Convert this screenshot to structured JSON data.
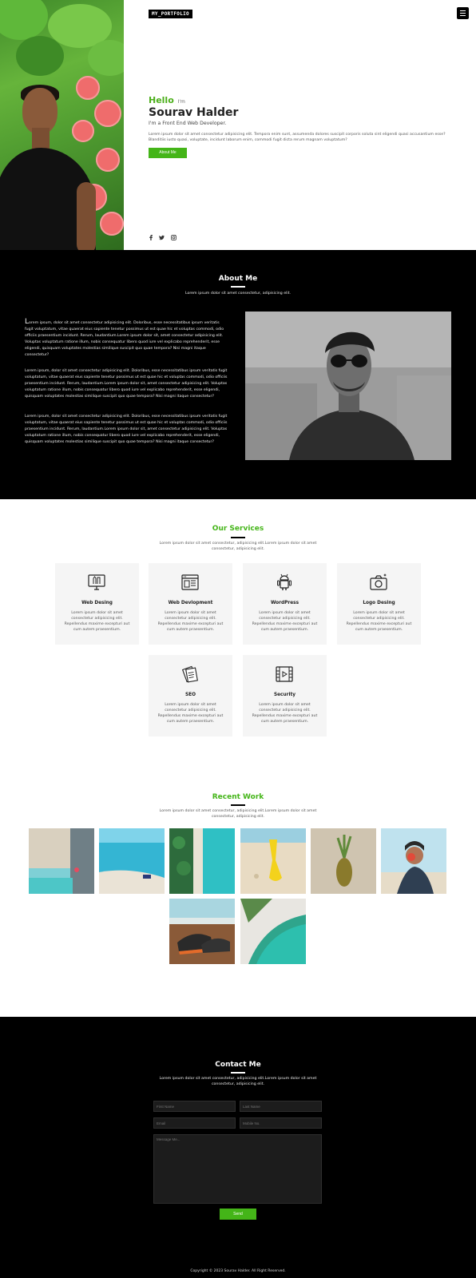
{
  "header": {
    "logo": "MY_PORTFOLIO"
  },
  "hero": {
    "hello": "Hello",
    "im": "I'm",
    "name": "Sourav Halder",
    "role": "I'm a Front End Web Developer.",
    "intro": "Lorem ipsum dolor sit amet consectetur adipisicing elit. Tempora enim sunt, assumenda dolores suscipit corporis soluta sint eligendi quasi accusantium esse? Blanditiis iusto quasi, voluptate, incidunt laborum enim, commodi fugit dicta rerum magnam voluptatum?",
    "button": "About Me",
    "social": [
      "facebook-icon",
      "twitter-icon",
      "instagram-icon"
    ]
  },
  "about": {
    "title": "About Me",
    "subtitle": "Lorem ipsum dolor sit amet consectetur, adipisicing elit.",
    "p1_drop": "L",
    "p1_rest": "orem ipsum, dolor sit amet consectetur adipisicing elit. Doloribus, esse necessitatibus ipsum veritatis fugit voluptatum, vitae quaerat eius sapiente tenetur possimus ut est quae hic et voluptas commodi, odio officiis praesentium incidunt. Rerum, laudantium.Lorem ipsum dolor sit, amet consectetur adipisicing elit. Voluptas voluptatum ratione illum, nobis consequatur libero quod iure vel explicabo reprehenderit, esse eligendi, quisquam voluptates molestias similique suscipit quo quae tempora? Nisi magni itaque consectetur?",
    "p2": "Lorem ipsum, dolor sit amet consectetur adipisicing elit. Doloribus, esse necessitatibus ipsum veritatis fugit voluptatum, vitae quaerat eius sapiente tenetur possimus ut est quae hic et voluptas commodi, odio officiis praesentium incidunt. Rerum, laudantium.Lorem ipsum dolor sit, amet consectetur adipisicing elit. Voluptas voluptatum ratione illum, nobis consequatur libero quod iure vel explicabo reprehenderit, esse eligendi, quisquam voluptates molestias similique suscipit quo quae tempora? Nisi magni itaque consectetur?",
    "p3": "Lorem ipsum, dolor sit amet consectetur adipisicing elit. Doloribus, esse necessitatibus ipsum veritatis fugit voluptatum, vitae quaerat eius sapiente tenetur possimus ut est quae hic et voluptas commodi, odio officiis praesentium incidunt. Rerum, laudantium.Lorem ipsum dolor sit, amet consectetur adipisicing elit. Voluptas voluptatum ratione illum, nobis consequatur libero quod iure vel explicabo reprehenderit, esse eligendi, quisquam voluptates molestias similique suscipit quo quae tempora? Nisi magni itaque consectetur?"
  },
  "services": {
    "title": "Our Services",
    "subtitle": "Lorem ipsum dolor sit amet consectetur, adipisicing elit.Lorem ipsum dolor sit amet consectetur, adipisicing elit.",
    "items": [
      {
        "title": "Web Desing",
        "desc": "Lorem ipsum dolor sit amet consectetur adipisicing elit. Repellendus maxime excepturi aut cum autem praesentium.",
        "icon": "monitor-design-icon"
      },
      {
        "title": "Web Devlopment",
        "desc": "Lorem ipsum dolor sit amet consectetur adipisicing elit. Repellendus maxime excepturi aut cum autem praesentium.",
        "icon": "browser-window-icon"
      },
      {
        "title": "WordPress",
        "desc": "Lorem ipsum dolor sit amet consectetur adipisicing elit. Repellendus maxime excepturi aut cum autem praesentium.",
        "icon": "android-robot-icon"
      },
      {
        "title": "Logo Desing",
        "desc": "Lorem ipsum dolor sit amet consectetur adipisicing elit. Repellendus maxime excepturi aut cum autem praesentium.",
        "icon": "camera-icon"
      },
      {
        "title": "SEO",
        "desc": "Lorem ipsum dolor sit amet consectetur adipisicing elit. Repellendus maxime excepturi aut cum autem praesentium.",
        "icon": "documents-icon"
      },
      {
        "title": "Security",
        "desc": "Lorem ipsum dolor sit amet consectetur adipisicing elit. Repellendus maxime excepturi aut cum autem praesentium.",
        "icon": "video-film-icon"
      }
    ]
  },
  "work": {
    "title": "Recent Work",
    "subtitle": "Lorem ipsum dolor sit amet consectetur, adipisicing elit.Lorem ipsum dolor sit amet consectetur, adipisicing elit."
  },
  "contact": {
    "title": "Contact Me",
    "subtitle": "Lorem ipsum dolor sit amet consectetur, adipisicing elit.Lorem ipsum dolor sit amet consectetur, adipisicing elit.",
    "first_name": "First Name",
    "last_name": "Last Name",
    "email": "Email",
    "mobile": "Mobile No.",
    "message": "Message Me...",
    "send": "Send"
  },
  "footer": {
    "copyright": "Copyright © 2023 Sourav Halder. All Right Reserved."
  },
  "colors": {
    "accent": "#44b518",
    "dark": "#000000",
    "card": "#f5f5f5"
  }
}
